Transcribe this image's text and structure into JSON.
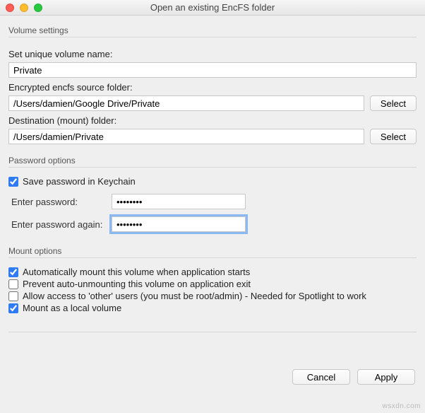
{
  "window": {
    "title": "Open an existing EncFS folder"
  },
  "volume_settings": {
    "group_label": "Volume settings",
    "name_label": "Set unique volume name:",
    "name_value": "Private",
    "source_label": "Encrypted encfs source folder:",
    "source_value": "/Users/damien/Google Drive/Private",
    "dest_label": "Destination (mount) folder:",
    "dest_value": "/Users/damien/Private",
    "select_label": "Select"
  },
  "password_options": {
    "group_label": "Password options",
    "save_keychain_label": "Save password in Keychain",
    "save_keychain_checked": true,
    "pw_label": "Enter password:",
    "pw_value": "••••••••",
    "pw2_label": "Enter password again:",
    "pw2_value": "••••••••"
  },
  "mount_options": {
    "group_label": "Mount options",
    "auto_mount_label": "Automatically mount this volume when application starts",
    "auto_mount_checked": true,
    "prevent_unmount_label": "Prevent auto-unmounting this volume on application exit",
    "prevent_unmount_checked": false,
    "allow_other_label": "Allow access to 'other' users (you must be root/admin) - Needed for Spotlight to work",
    "allow_other_checked": false,
    "local_volume_label": "Mount as a local volume",
    "local_volume_checked": true
  },
  "footer": {
    "cancel": "Cancel",
    "apply": "Apply"
  },
  "watermark": "wsxdn.com"
}
